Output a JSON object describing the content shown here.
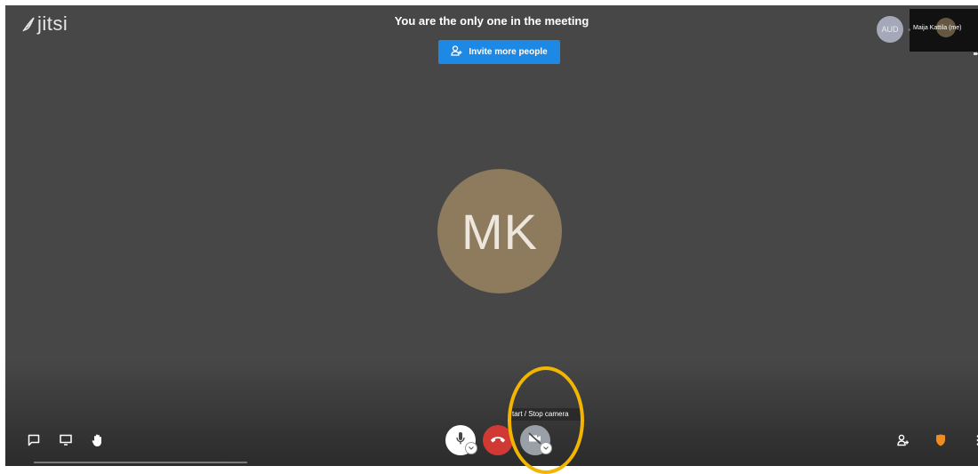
{
  "app": {
    "logo_text": "jitsi"
  },
  "meeting": {
    "title": "You are the only one in the meeting",
    "invite_label": "Invite more people"
  },
  "participants": {
    "remote_initials": "AUD",
    "local_name": "Maija Kattila (me)",
    "main_initials": "MK"
  },
  "toolbar": {
    "left": [
      {
        "name": "chat-button",
        "icon": "chat-icon"
      },
      {
        "name": "screenshare-button",
        "icon": "screen-icon"
      },
      {
        "name": "raise-hand-button",
        "icon": "hand-icon"
      }
    ],
    "center": {
      "mic": {
        "icon": "microphone-icon"
      },
      "hangup": {
        "icon": "phone-hangup-icon"
      },
      "camera": {
        "icon": "camera-off-icon",
        "tooltip": "tart / Stop camera"
      }
    },
    "right": [
      {
        "name": "invite-toolbar-button",
        "icon": "add-person-icon"
      },
      {
        "name": "security-button",
        "icon": "shield-icon"
      },
      {
        "name": "more-button",
        "icon": "more-vertical-icon"
      }
    ]
  },
  "colors": {
    "stage": "#474747",
    "accent_blue": "#1e88e5",
    "hangup_red": "#d13a34",
    "avatar_brown": "#8e7a5c",
    "highlight_yellow": "#f2b500",
    "shield_orange": "#f08c1e"
  }
}
